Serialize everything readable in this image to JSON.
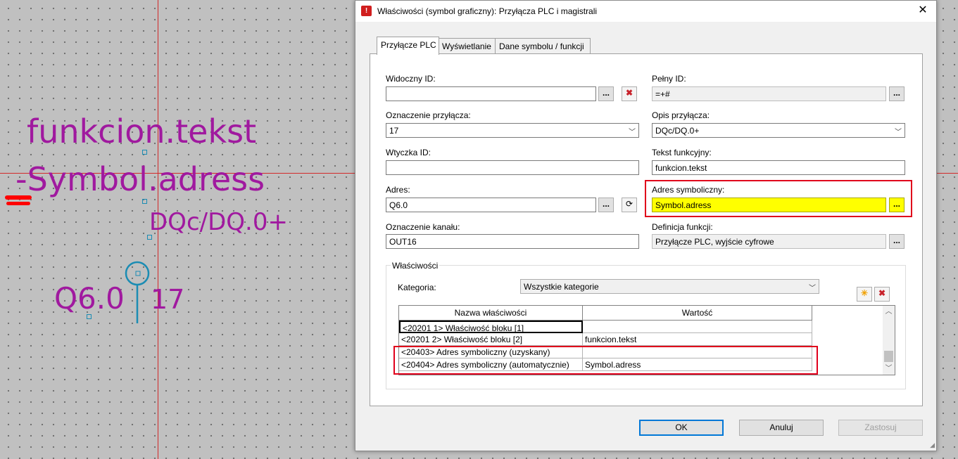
{
  "canvas": {
    "function_text": "funkcion.tekst",
    "symbol_address": "-Symbol.adress",
    "connection_desc": "DQc/DQ.0+",
    "address": "Q6.0",
    "connection_number": "17"
  },
  "dialog": {
    "title": "Właściwości (symbol graficzny): Przyłącza PLC i magistrali",
    "tabs": [
      "Przyłącze PLC",
      "Wyświetlanie",
      "Dane symbolu / funkcji"
    ],
    "fields": {
      "visible_id": {
        "label": "Widoczny ID:",
        "value": ""
      },
      "full_id": {
        "label": "Pełny ID:",
        "value": "=+#"
      },
      "connection_designation": {
        "label": "Oznaczenie przyłącza:",
        "value": "17"
      },
      "connection_description": {
        "label": "Opis przyłącza:",
        "value": "DQc/DQ.0+"
      },
      "plug_id": {
        "label": "Wtyczka ID:",
        "value": ""
      },
      "function_text": {
        "label": "Tekst funkcyjny:",
        "value": "funkcion.tekst"
      },
      "address": {
        "label": "Adres:",
        "value": "Q6.0"
      },
      "symbolic_address": {
        "label": "Adres symboliczny:",
        "value": "Symbol.adress"
      },
      "channel_designation": {
        "label": "Oznaczenie kanału:",
        "value": "OUT16"
      },
      "function_definition": {
        "label": "Definicja funkcji:",
        "value": "Przyłącze PLC, wyjście cyfrowe"
      }
    },
    "ellipsis": "...",
    "properties": {
      "group_label": "Właściwości",
      "category_label": "Kategoria:",
      "category_value": "Wszystkie kategorie",
      "columns": [
        "Nazwa właściwości",
        "Wartość"
      ],
      "rows": [
        {
          "name": "<20201 1> Właściwość bloku [1]",
          "value": ""
        },
        {
          "name": "<20201 2> Właściwość bloku [2]",
          "value": "funkcion.tekst"
        },
        {
          "name": "<20403> Adres symboliczny (uzyskany)",
          "value": ""
        },
        {
          "name": "<20404> Adres symboliczny (automatycznie)",
          "value": "Symbol.adress"
        }
      ]
    },
    "buttons": {
      "ok": "OK",
      "cancel": "Anuluj",
      "apply": "Zastosuj"
    }
  },
  "colors": {
    "highlight": "#ffff00",
    "outline": "#e0001b",
    "canvas_text": "#a0199f"
  }
}
